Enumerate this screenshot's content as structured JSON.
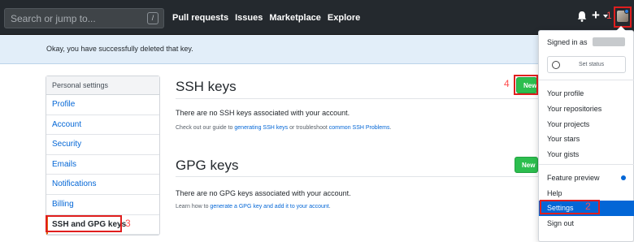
{
  "header": {
    "search_placeholder": "Search or jump to...",
    "search_shortcut": "/",
    "nav": [
      "Pull requests",
      "Issues",
      "Marketplace",
      "Explore"
    ]
  },
  "flash": {
    "message": "Okay, you have successfully deleted that key."
  },
  "sidebar": {
    "heading": "Personal settings",
    "items": [
      {
        "label": "Profile"
      },
      {
        "label": "Account"
      },
      {
        "label": "Security"
      },
      {
        "label": "Emails"
      },
      {
        "label": "Notifications"
      },
      {
        "label": "Billing"
      },
      {
        "label": "SSH and GPG keys"
      }
    ]
  },
  "ssh": {
    "title": "SSH keys",
    "button_label": "New",
    "empty_text": "There are no SSH keys associated with your account.",
    "note_prefix": "Check out our guide to ",
    "note_link1": "generating SSH keys",
    "note_middle": " or troubleshoot ",
    "note_link2": "common SSH Problems",
    "note_suffix": "."
  },
  "gpg": {
    "title": "GPG keys",
    "button_label": "New GPG key",
    "empty_text": "There are no GPG keys associated with your account.",
    "note_prefix": "Learn how to ",
    "note_link": "generate a GPG key and add it to your account",
    "note_suffix": "."
  },
  "dropdown": {
    "signed_in_as": "Signed in as",
    "set_status": "Set status",
    "items_group1": [
      "Your profile",
      "Your repositories",
      "Your projects",
      "Your stars",
      "Your gists"
    ],
    "feature_preview": "Feature preview",
    "help": "Help",
    "settings": "Settings",
    "sign_out": "Sign out"
  },
  "annotations": {
    "n1": "1",
    "n2": "2",
    "n3": "3",
    "n4": "4"
  },
  "colors": {
    "header_bg": "#24292e",
    "accent_red": "#e01e1e",
    "link_blue": "#0366d6",
    "green": "#2cbe4e",
    "flash_bg": "#e2eef9"
  }
}
